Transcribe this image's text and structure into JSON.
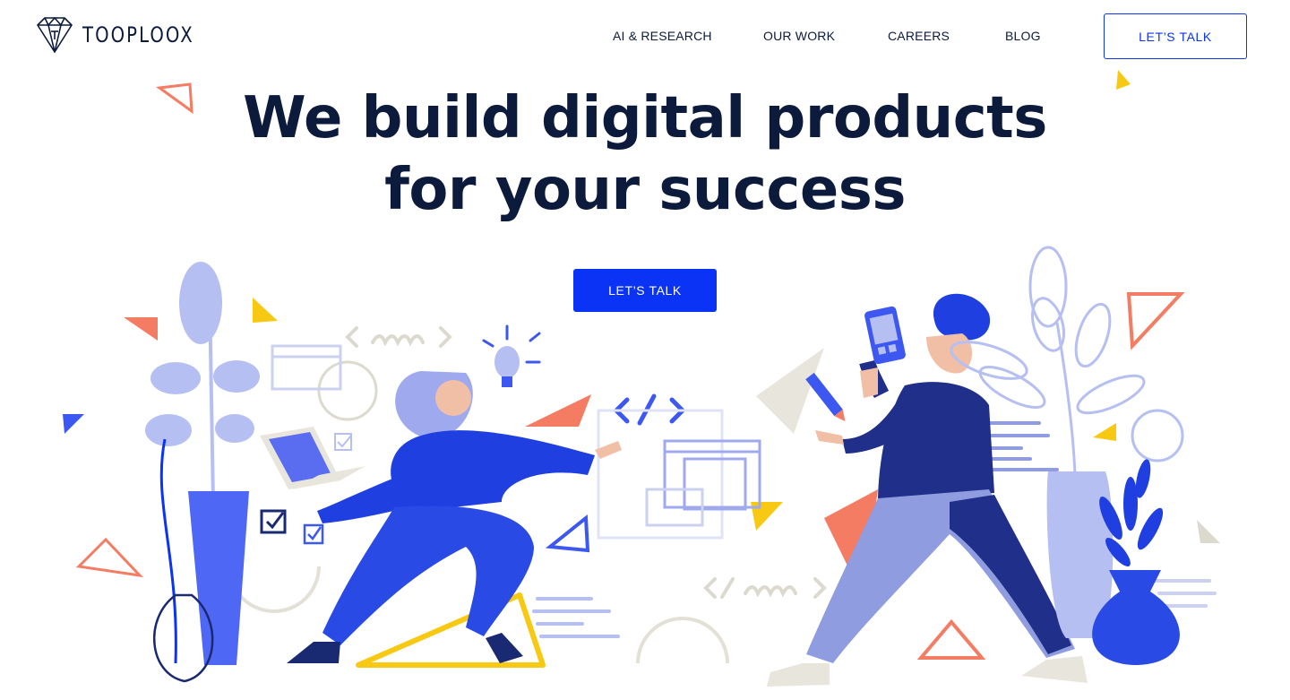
{
  "header": {
    "logo_text": "TOOPLOOX",
    "nav": {
      "ai_research": "AI & RESEARCH",
      "our_work": "OUR WORK",
      "careers": "CAREERS",
      "blog": "BLOG"
    },
    "cta_label": "LET’S TALK"
  },
  "hero": {
    "title_line1": "We build digital products",
    "title_line2": "for your success",
    "cta_label": "LET’S TALK"
  },
  "colors": {
    "brand_blue": "#0b33f5",
    "navy": "#0c1a3c",
    "light_blue": "#a9b4ee",
    "coral": "#f47c62",
    "yellow": "#f7c913",
    "beige": "#e3e0d6"
  }
}
